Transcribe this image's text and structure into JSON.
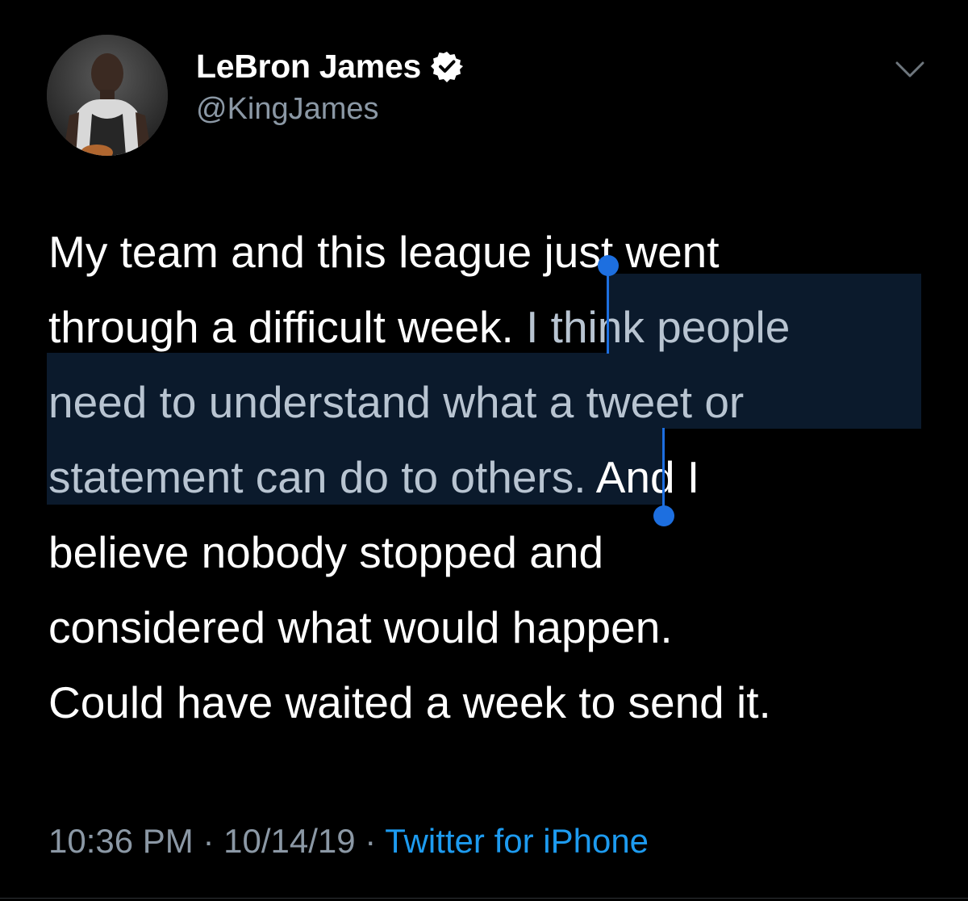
{
  "author": {
    "display_name": "LeBron James",
    "handle": "@KingJames",
    "verified": true,
    "avatar_icon": "profile-avatar"
  },
  "tweet": {
    "lines": [
      {
        "plain": "My team and this league just went"
      },
      {
        "plain": "through a difficult week. ",
        "selected": "I think people"
      },
      {
        "selected": "need to understand what a tweet or"
      },
      {
        "selected": "statement can do to others.",
        "plain": " And I"
      },
      {
        "plain": "believe nobody stopped and"
      },
      {
        "plain": "considered what would happen."
      },
      {
        "plain": "Could have waited a week to send it."
      }
    ]
  },
  "meta": {
    "time": "10:36 PM",
    "date": "10/14/19",
    "separator": "·",
    "source": "Twitter for iPhone"
  },
  "colors": {
    "background": "#000000",
    "text": "#ffffff",
    "secondary": "#8b98a5",
    "link": "#1d9bf0",
    "selection": "#0b1a2c",
    "selection_handle": "#1d6fe0",
    "verified_badge": "#ffffff"
  },
  "icons": {
    "verified": "verified-badge-icon",
    "chevron": "chevron-down-icon"
  }
}
